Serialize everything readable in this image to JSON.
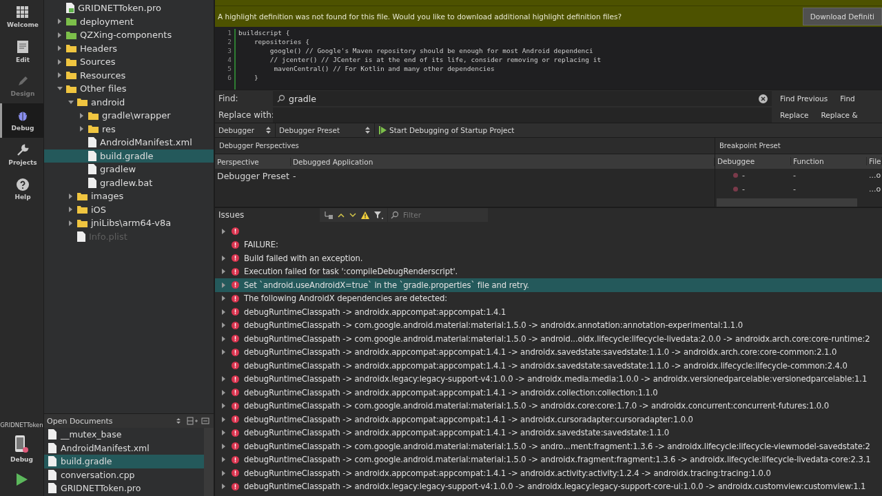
{
  "mode_bar": {
    "items": [
      {
        "label": "Welcome",
        "selected": false,
        "disabled": false
      },
      {
        "label": "Edit",
        "selected": false,
        "disabled": false
      },
      {
        "label": "Design",
        "selected": false,
        "disabled": true
      },
      {
        "label": "Debug",
        "selected": true,
        "disabled": false
      },
      {
        "label": "Projects",
        "selected": false,
        "disabled": false
      },
      {
        "label": "Help",
        "selected": false,
        "disabled": false
      }
    ],
    "kit": {
      "project": "GRIDNETToken",
      "build": "Debug"
    }
  },
  "project_tree": {
    "items": [
      {
        "label": "GRIDNETToken.pro",
        "kind": "pro"
      },
      {
        "label": "deployment",
        "kind": "group",
        "expanded": false
      },
      {
        "label": "QZXing-components",
        "kind": "group",
        "expanded": false
      },
      {
        "label": "Headers",
        "kind": "folder",
        "expanded": false
      },
      {
        "label": "Sources",
        "kind": "folder",
        "expanded": false
      },
      {
        "label": "Resources",
        "kind": "folder",
        "expanded": false
      },
      {
        "label": "Other files",
        "kind": "folder",
        "expanded": true,
        "children": [
          {
            "label": "android",
            "kind": "folder",
            "expanded": true,
            "children": [
              {
                "label": "gradle\\wrapper",
                "kind": "folder",
                "expanded": false
              },
              {
                "label": "res",
                "kind": "folder",
                "expanded": false
              },
              {
                "label": "AndroidManifest.xml",
                "kind": "file",
                "selected": false
              },
              {
                "label": "build.gradle",
                "kind": "file",
                "selected": true
              },
              {
                "label": "gradlew",
                "kind": "file",
                "selected": false
              },
              {
                "label": "gradlew.bat",
                "kind": "file",
                "selected": false
              }
            ]
          },
          {
            "label": "images",
            "kind": "folder",
            "expanded": false
          },
          {
            "label": "iOS",
            "kind": "folder",
            "expanded": false
          },
          {
            "label": "jniLibs\\arm64-v8a",
            "kind": "folder",
            "expanded": false
          },
          {
            "label": "Info.plist",
            "kind": "file",
            "selected": false,
            "disabled": true
          }
        ]
      }
    ]
  },
  "open_documents": {
    "title": "Open Documents",
    "items": [
      {
        "label": "__mutex_base",
        "selected": false
      },
      {
        "label": "AndroidManifest.xml",
        "selected": false
      },
      {
        "label": "build.gradle",
        "selected": true
      },
      {
        "label": "conversation.cpp",
        "selected": false
      },
      {
        "label": "GRIDNETToken.pro",
        "selected": false
      }
    ]
  },
  "info_bar": {
    "message": "A highlight definition was not found for this file. Would you like to download additional highlight definition files?",
    "button": "Download Definiti"
  },
  "editor": {
    "lines": [
      {
        "number": "1",
        "text": "buildscript {"
      },
      {
        "number": "2",
        "text": "    repositories {"
      },
      {
        "number": "3",
        "text": "        google() // Google's Maven repository should be enough for most Android dependenci"
      },
      {
        "number": "4",
        "text": "        // jcenter() // JCenter is at the end of its life, consider removing or replacing it"
      },
      {
        "number": "5",
        "text": "         mavenCentral() // For Kotlin and many other dependencies"
      },
      {
        "number": "6",
        "text": "    }"
      }
    ]
  },
  "find_bar": {
    "find_label": "Find:",
    "find_value": "gradle",
    "replace_label": "Replace with:",
    "buttons": [
      "Find Previous",
      "Find",
      "Replace",
      "Replace &"
    ]
  },
  "debug_toolbar": {
    "combos": [
      "Debugger",
      "Debugger Preset"
    ],
    "start_button": "Start Debugging of Startup Project"
  },
  "perspectives": {
    "title": "Debugger Perspectives",
    "columns": [
      "Perspective",
      "Debugged Application"
    ],
    "rows": [
      [
        "Debugger Preset",
        "-"
      ]
    ]
  },
  "breakpoints": {
    "title": "Breakpoint Preset",
    "columns": [
      "Debuggee",
      "Function",
      "File"
    ],
    "rows": [
      [
        "-",
        "-",
        "...o"
      ],
      [
        "-",
        "-",
        "...o"
      ]
    ]
  },
  "issues": {
    "title": "Issues",
    "filter_placeholder": "Filter",
    "rows": [
      {
        "text": "",
        "expandable": true,
        "selected": false
      },
      {
        "text": "FAILURE:",
        "expandable": false,
        "selected": false
      },
      {
        "text": "Build failed with an exception.",
        "expandable": true,
        "selected": false
      },
      {
        "text": "Execution failed for task ':compileDebugRenderscript'.",
        "expandable": true,
        "selected": false
      },
      {
        "text": "Set `android.useAndroidX=true` in the `gradle.properties` file and retry.",
        "expandable": true,
        "selected": true
      },
      {
        "text": "The following AndroidX dependencies are detected:",
        "expandable": true,
        "selected": false
      },
      {
        "text": "debugRuntimeClasspath -> androidx.appcompat:appcompat:1.4.1",
        "expandable": true,
        "selected": false
      },
      {
        "text": "debugRuntimeClasspath -> com.google.android.material:material:1.5.0 -> androidx.annotation:annotation-experimental:1.1.0",
        "expandable": true,
        "selected": false
      },
      {
        "text": "debugRuntimeClasspath -> com.google.android.material:material:1.5.0 -> android...oidx.lifecycle:lifecycle-livedata:2.0.0 -> androidx.arch.core:core-runtime:2",
        "expandable": true,
        "selected": false
      },
      {
        "text": "debugRuntimeClasspath -> androidx.appcompat:appcompat:1.4.1 -> androidx.savedstate:savedstate:1.1.0 -> androidx.arch.core:core-common:2.1.0",
        "expandable": true,
        "selected": false
      },
      {
        "text": "debugRuntimeClasspath -> androidx.appcompat:appcompat:1.4.1 -> androidx.savedstate:savedstate:1.1.0 -> androidx.lifecycle:lifecycle-common:2.4.0",
        "expandable": false,
        "selected": false
      },
      {
        "text": "debugRuntimeClasspath -> androidx.legacy:legacy-support-v4:1.0.0 -> androidx.media:media:1.0.0 -> androidx.versionedparcelable:versionedparcelable:1.1",
        "expandable": true,
        "selected": false
      },
      {
        "text": "debugRuntimeClasspath -> androidx.appcompat:appcompat:1.4.1 -> androidx.collection:collection:1.1.0",
        "expandable": true,
        "selected": false
      },
      {
        "text": "debugRuntimeClasspath -> com.google.android.material:material:1.5.0 -> androidx.core:core:1.7.0 -> androidx.concurrent:concurrent-futures:1.0.0",
        "expandable": true,
        "selected": false
      },
      {
        "text": "debugRuntimeClasspath -> androidx.appcompat:appcompat:1.4.1 -> androidx.cursoradapter:cursoradapter:1.0.0",
        "expandable": true,
        "selected": false
      },
      {
        "text": "debugRuntimeClasspath -> androidx.appcompat:appcompat:1.4.1 -> androidx.savedstate:savedstate:1.1.0",
        "expandable": true,
        "selected": false
      },
      {
        "text": "debugRuntimeClasspath -> com.google.android.material:material:1.5.0 -> andro...ment:fragment:1.3.6 -> androidx.lifecycle:lifecycle-viewmodel-savedstate:2",
        "expandable": true,
        "selected": false
      },
      {
        "text": "debugRuntimeClasspath -> com.google.android.material:material:1.5.0 -> androidx.fragment:fragment:1.3.6 -> androidx.lifecycle:lifecycle-livedata-core:2.3.1",
        "expandable": true,
        "selected": false
      },
      {
        "text": "debugRuntimeClasspath -> androidx.appcompat:appcompat:1.4.1 -> androidx.activity:activity:1.2.4 -> androidx.tracing:tracing:1.0.0",
        "expandable": true,
        "selected": false
      },
      {
        "text": "debugRuntimeClasspath -> androidx.legacy:legacy-support-v4:1.0.0 -> androidx.legacy:legacy-support-core-ui:1.0.0 -> androidx.customview:customview:1.1",
        "expandable": true,
        "selected": false
      }
    ]
  }
}
